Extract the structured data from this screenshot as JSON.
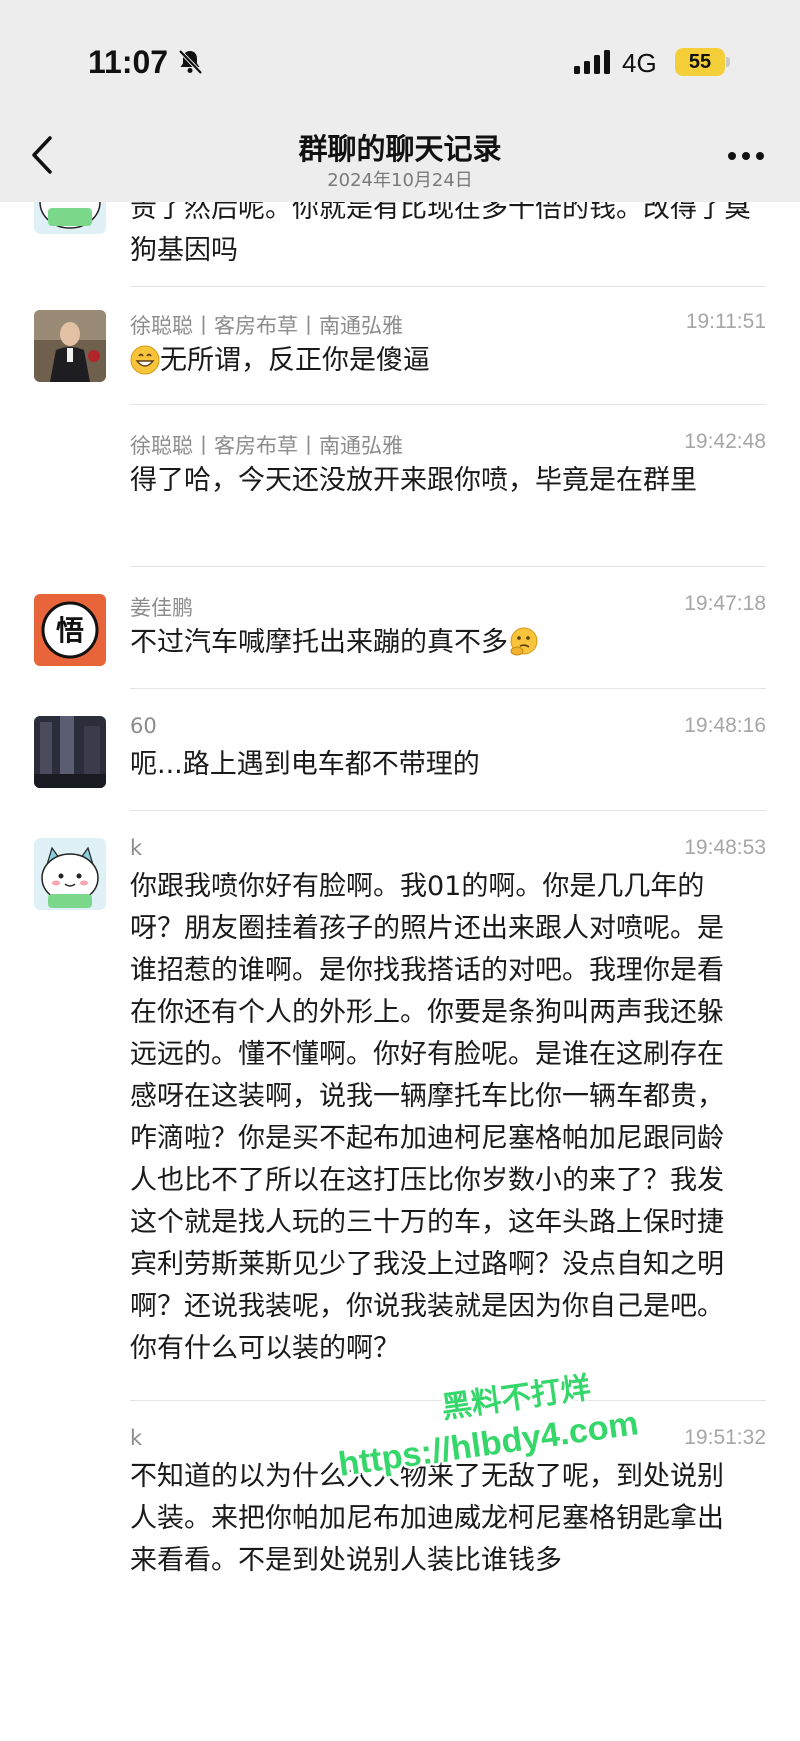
{
  "status_bar": {
    "time": "11:07",
    "network": "4G",
    "battery": "55"
  },
  "header": {
    "title": "群聊的聊天记录",
    "subtitle": "2024年10月24日"
  },
  "messages": [
    {
      "sender": "",
      "time": "",
      "text": "贵了然后呢。你就是有比现在多十倍的钱。改得了臭狗基因吗"
    },
    {
      "sender": "徐聪聪丨客房布草丨南通弘雅",
      "time": "19:11:51",
      "text": "无所谓，反正你是傻逼"
    },
    {
      "sender": "徐聪聪丨客房布草丨南通弘雅",
      "time": "19:42:48",
      "text": "得了哈，今天还没放开来跟你喷，毕竟是在群里"
    },
    {
      "sender": "姜佳鹏",
      "time": "19:47:18",
      "text": "不过汽车喊摩托出来蹦的真不多"
    },
    {
      "sender": "60",
      "time": "19:48:16",
      "text": "呃...路上遇到电车都不带理的"
    },
    {
      "sender": "k",
      "time": "19:48:53",
      "text": "你跟我喷你好有脸啊。我01的啊。你是几几年的呀？朋友圈挂着孩子的照片还出来跟人对喷呢。是谁招惹的谁啊。是你找我搭话的对吧。我理你是看在你还有个人的外形上。你要是条狗叫两声我还躲远远的。懂不懂啊。你好有脸呢。是谁在这刷存在感呀在这装啊，说我一辆摩托车比你一辆车都贵，咋滴啦？你是买不起布加迪柯尼塞格帕加尼跟同龄人也比不了所以在这打压比你岁数小的来了？我发这个就是找人玩的三十万的车，这年头路上保时捷宾利劳斯莱斯见少了我没上过路啊？没点自知之明啊？还说我装呢，你说我装就是因为你自己是吧。你有什么可以装的啊？"
    },
    {
      "sender": "k",
      "time": "19:51:32",
      "text": "不知道的以为什么大人物来了无敌了呢，到处说别人装。来把你帕加尼布加迪威龙柯尼塞格钥匙拿出来看看。不是到处说别人装比谁钱多"
    }
  ],
  "watermark": {
    "line1": "黑料不打烊",
    "line2": "https://hlbdy4.com"
  },
  "colors": {
    "header_bg": "#ededed",
    "battery": "#f4cf3a",
    "watermark": "#35d66a"
  }
}
